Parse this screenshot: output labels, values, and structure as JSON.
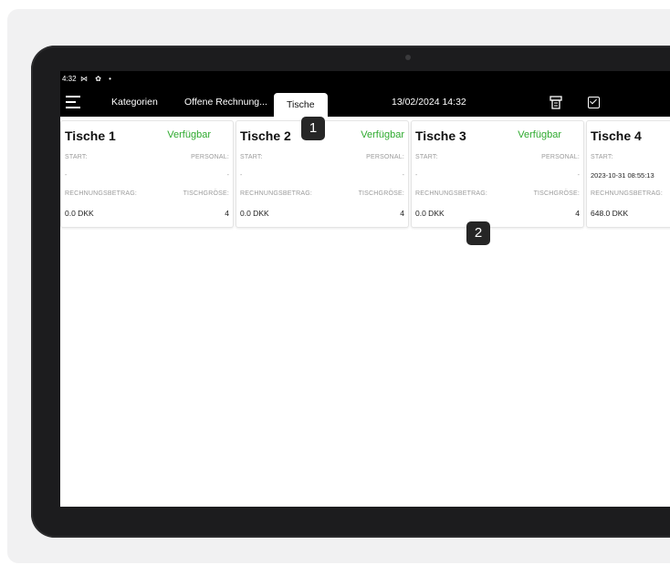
{
  "status_bar": {
    "time": "4:32",
    "icons": "⋈ ✿ •"
  },
  "app_bar": {
    "tabs": [
      {
        "label": "Kategorien"
      },
      {
        "label": "Offene Rechnung..."
      },
      {
        "label": "Tische"
      }
    ],
    "datetime": "13/02/2024 14:32"
  },
  "tables": [
    {
      "name": "Tische 1",
      "status": "Verfügbar",
      "start_label": "START:",
      "start_value": "-",
      "staff_label": "PERSONAL:",
      "staff_value": "-",
      "amount_label": "RECHNUNGSBETRAG:",
      "amount_value": "0.0 DKK",
      "size_label": "TISCHGRÖSE:",
      "size_value": "4"
    },
    {
      "name": "Tische 2",
      "status": "Verfügbar",
      "start_label": "START:",
      "start_value": "-",
      "staff_label": "PERSONAL:",
      "staff_value": "-",
      "amount_label": "RECHNUNGSBETRAG:",
      "amount_value": "0.0 DKK",
      "size_label": "TISCHGRÖSE:",
      "size_value": "4"
    },
    {
      "name": "Tische 3",
      "status": "Verfügbar",
      "start_label": "START:",
      "start_value": "-",
      "staff_label": "PERSONAL:",
      "staff_value": "-",
      "amount_label": "RECHNUNGSBETRAG:",
      "amount_value": "0.0 DKK",
      "size_label": "TISCHGRÖSE:",
      "size_value": "4"
    },
    {
      "name": "Tische 4",
      "status": "",
      "start_label": "START:",
      "start_value": "2023-10-31 08:55:13",
      "staff_label": "",
      "staff_value": "",
      "amount_label": "RECHNUNGSBETRAG:",
      "amount_value": "648.0 DKK",
      "size_label": "",
      "size_value": ""
    }
  ],
  "annotations": {
    "badge1": "1",
    "badge2": "2"
  },
  "colors": {
    "available_green": "#2eaa2e",
    "bar_black": "#000000"
  },
  "icons": {
    "menu": "hamburger-icon",
    "receipt": "receipt-icon",
    "check": "checkbox-icon"
  }
}
